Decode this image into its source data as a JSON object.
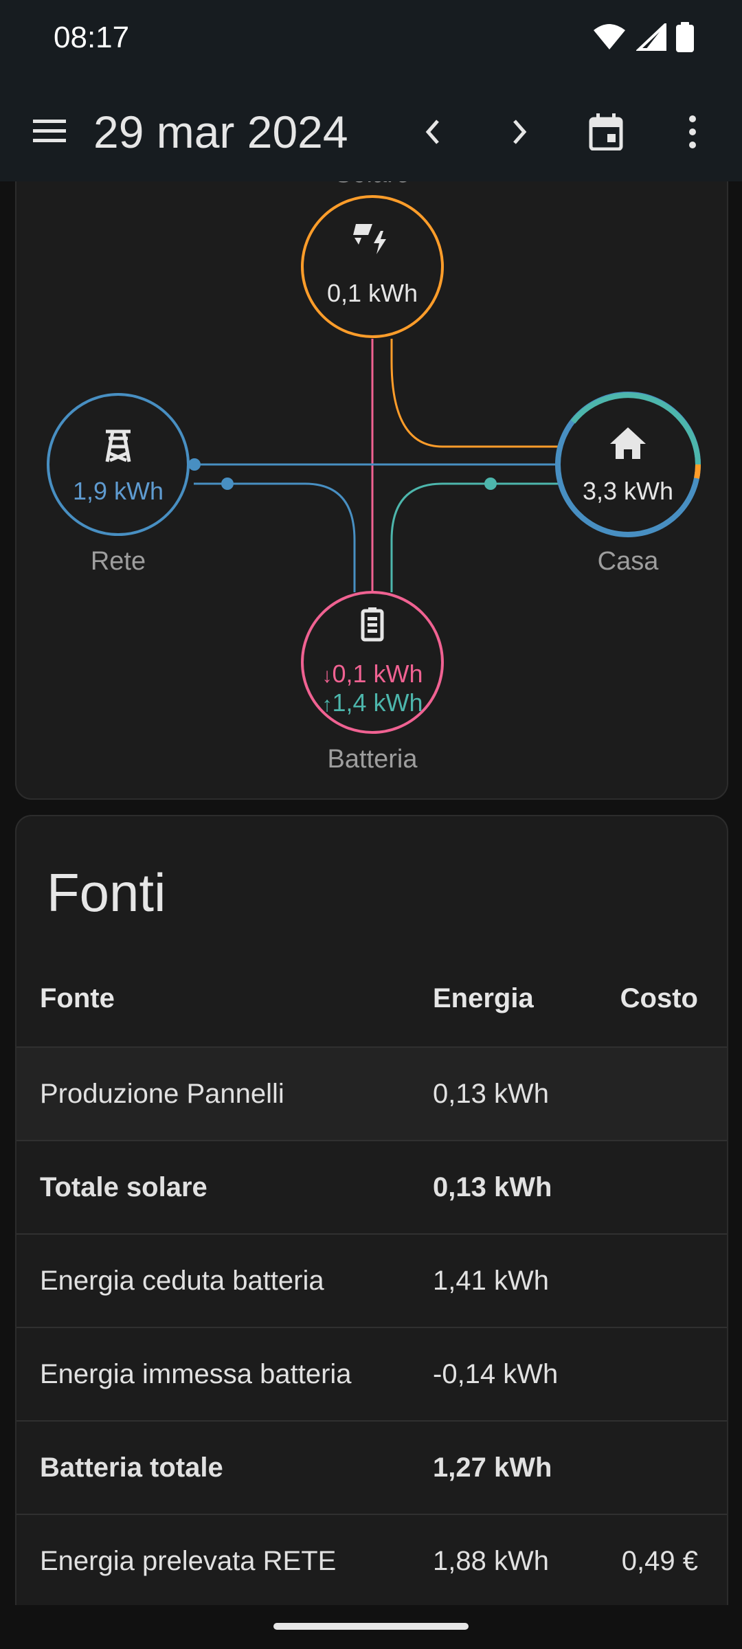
{
  "status": {
    "time": "08:17"
  },
  "appbar": {
    "title": "29 mar 2024",
    "menu_icon": "hamburger-menu-icon",
    "prev_icon": "chevron-left-icon",
    "next_icon": "chevron-right-icon",
    "calendar_icon": "calendar-icon",
    "more_icon": "more-vert-icon"
  },
  "flow": {
    "solar": {
      "label": "Solare",
      "value": "0,1 kWh",
      "icon": "solar-power-icon",
      "color": "#ff9d2a"
    },
    "grid": {
      "label": "Rete",
      "value": "1,9 kWh",
      "icon": "transmission-tower-icon",
      "color": "#488fc2"
    },
    "home": {
      "label": "Casa",
      "value": "3,3 kWh",
      "icon": "home-icon"
    },
    "battery": {
      "label": "Batteria",
      "value_in": "0,1 kWh",
      "value_out": "1,4 kWh",
      "arrow_in": "↓",
      "arrow_out": "↑",
      "icon": "battery-icon",
      "color": "#f06292",
      "color_out": "#4db6ac"
    }
  },
  "fonti": {
    "title": "Fonti",
    "headers": {
      "source": "Fonte",
      "energy": "Energia",
      "cost": "Costo"
    },
    "rows": [
      {
        "source": "Produzione Pannelli",
        "energy": "0,13 kWh",
        "cost": ""
      },
      {
        "source": "Totale solare",
        "energy": "0,13 kWh",
        "cost": ""
      },
      {
        "source": "Energia ceduta batteria",
        "energy": "1,41 kWh",
        "cost": ""
      },
      {
        "source": "Energia immessa batteria",
        "energy": "-0,14 kWh",
        "cost": ""
      },
      {
        "source": "Batteria totale",
        "energy": "1,27 kWh",
        "cost": ""
      },
      {
        "source": "Energia prelevata RETE",
        "energy": "1,88 kWh",
        "cost": "0,49 €"
      }
    ]
  }
}
